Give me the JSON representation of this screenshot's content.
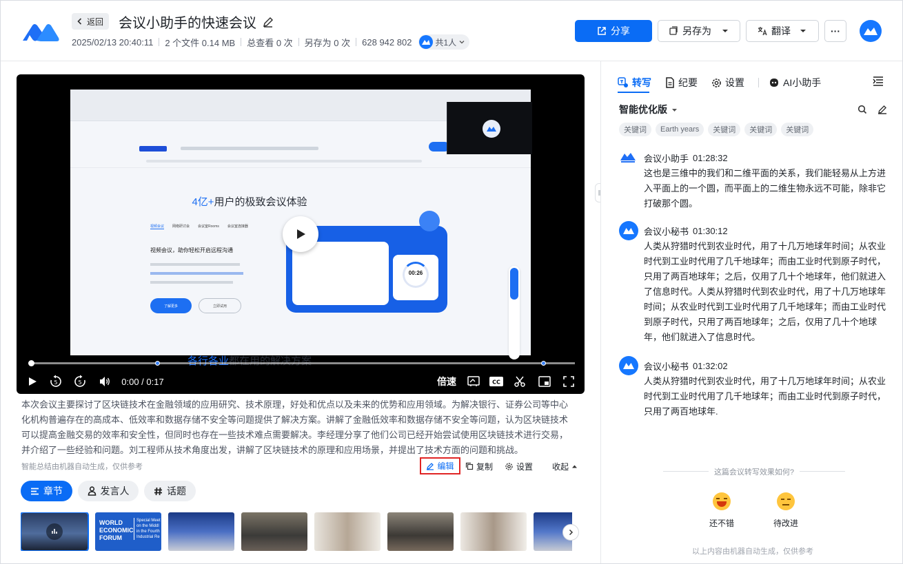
{
  "header": {
    "back_label": "返回",
    "title": "会议小助手的快速会议",
    "meta": {
      "datetime": "2025/02/13 20:40:11",
      "files": "2 个文件 0.14 MB",
      "views": "总查看 0 次",
      "saves": "另存为 0 次",
      "meeting_id": "628 942 802",
      "shared_with": "共1人"
    },
    "buttons": {
      "share": "分享",
      "save_as": "另存为",
      "translate": "翻译",
      "more": "···"
    },
    "colors": {
      "primary": "#0a6cf5",
      "brand": "#1677ff"
    }
  },
  "player": {
    "screenshot_text": {
      "headline_num": "4亿+",
      "headline_rest": "用户的极致会议体验",
      "sub_title": "视频会议，助你轻松开启远程沟通",
      "section_num": "各行各业",
      "section_rest": "都在用的解决方案",
      "timer": "00:26",
      "btn_primary": "了解更多",
      "btn_secondary": "立即试用",
      "tabs": [
        "视频会议",
        "网络研讨会",
        "会议室Rooms",
        "会议室连接器"
      ]
    },
    "time": "0:00 / 0:17",
    "speed_label": "倍速",
    "progress_fraction": 0.0
  },
  "summary": {
    "text": "本次会议主要探讨了区块链技术在金融领域的应用研究、技术原理，好处和优点以及未来的优势和应用领域。为解决银行、证券公司等中心化机构普遍存在的高成本、低效率和数据存储不安全等问题提供了解决方案。讲解了金融低效率和数据存储不安全等问题，认为区块链技术可以提高金融交易的效率和安全性，但同时也存在一些技术难点需要解决。李经理分享了他们公司已经开始尝试使用区块链技术进行交易，并介绍了一些经验和问题。刘工程师从技术角度出发，讲解了区块链技术的原理和应用场景，并提出了技术方面的问题和挑战。",
    "ai_note": "智能总结由机器自动生成，仅供参考",
    "tools": {
      "edit": "编辑",
      "copy": "复制",
      "settings": "设置",
      "collapse": "收起"
    }
  },
  "pills": {
    "chapters": "章节",
    "speakers": "发言人",
    "topics": "话题"
  },
  "thumbnails": {
    "wef": {
      "title_lines": [
        "WORLD",
        "ECONOMIC",
        "FORUM"
      ],
      "subtitle_lines": [
        "Special Meet",
        "on the Middl",
        "in the Fourth",
        "Industrial Re"
      ]
    }
  },
  "right_panel": {
    "tabs": [
      "转写",
      "纪要",
      "设置",
      "AI小助手"
    ],
    "version": "智能优化版",
    "keywords": [
      "关键词",
      "Earth years",
      "关键词",
      "关键词",
      "关键词"
    ],
    "messages": [
      {
        "speaker": "会议小助手",
        "time": "01:28:32",
        "text": "这也是三维中的我们和二维平面的关系，我们能轻易从上方进入平面上的一个圆，而平面上的二维生物永远不可能，除非它打破那个圆。"
      },
      {
        "speaker": "会议小秘书",
        "time": "01:30:12",
        "text": "人类从狩猎时代到农业时代，用了十几万地球年时间；从农业时代到工业时代用了几千地球年；而由工业时代到原子时代，只用了两百地球年；之后，仅用了几十个地球年，他们就进入了信息时代。人类从狩猎时代到农业时代，用了十几万地球年时间；从农业时代到工业时代用了几千地球年；而由工业时代到原子时代，只用了两百地球年；之后，仅用了几十个地球年，他们就进入了信息时代。"
      },
      {
        "speaker": "会议小秘书",
        "time": "01:32:02",
        "text": "人类从狩猎时代到农业时代，用了十几万地球年时间；从农业时代到工业时代用了几千地球年；而由工业时代到原子时代，只用了两百地球年."
      }
    ],
    "feedback_question": "这篇会议转写效果如何?",
    "feedback_good": "还不错",
    "feedback_bad": "待改进",
    "footer_note": "以上内容由机器自动生成，仅供参考"
  }
}
